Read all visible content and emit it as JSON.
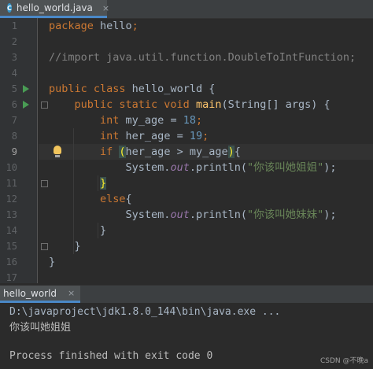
{
  "editor_tab": {
    "label": "hello_world.java",
    "close": "×"
  },
  "file_icon": "java-class-icon",
  "code_lines": [
    {
      "n": "1",
      "segs": [
        {
          "t": "package ",
          "c": "kw"
        },
        {
          "t": "hello",
          "c": ""
        },
        {
          "t": ";",
          "c": "kw"
        }
      ]
    },
    {
      "n": "2",
      "segs": []
    },
    {
      "n": "3",
      "segs": [
        {
          "t": "//import java.util.function.DoubleToIntFunction;",
          "c": "cm"
        }
      ]
    },
    {
      "n": "4",
      "segs": []
    },
    {
      "n": "5",
      "segs": [
        {
          "t": "public class ",
          "c": "kw"
        },
        {
          "t": "hello_world {",
          "c": ""
        }
      ]
    },
    {
      "n": "6",
      "segs": [
        {
          "t": "    public static void ",
          "c": "kw"
        },
        {
          "t": "main",
          "c": "fn"
        },
        {
          "t": "(String[] args) {",
          "c": ""
        }
      ]
    },
    {
      "n": "7",
      "segs": [
        {
          "t": "        int ",
          "c": "kw"
        },
        {
          "t": "my_age = ",
          "c": ""
        },
        {
          "t": "18",
          "c": "num"
        },
        {
          "t": ";",
          "c": "kw"
        }
      ]
    },
    {
      "n": "8",
      "segs": [
        {
          "t": "        int ",
          "c": "kw"
        },
        {
          "t": "her_age = ",
          "c": ""
        },
        {
          "t": "19",
          "c": "num"
        },
        {
          "t": ";",
          "c": "kw"
        }
      ]
    },
    {
      "n": "9",
      "segs": [
        {
          "t": "        if ",
          "c": "kw"
        },
        {
          "t": "(",
          "c": "br"
        },
        {
          "t": "her_age > my_age",
          "c": ""
        },
        {
          "t": ")",
          "c": "br"
        },
        {
          "t": "{",
          "c": ""
        }
      ]
    },
    {
      "n": "10",
      "segs": [
        {
          "t": "            System.",
          "c": ""
        },
        {
          "t": "out",
          "c": "it"
        },
        {
          "t": ".println(",
          "c": ""
        },
        {
          "t": "\"你该叫她姐姐\"",
          "c": "str"
        },
        {
          "t": ");",
          "c": ""
        }
      ]
    },
    {
      "n": "11",
      "segs": [
        {
          "t": "        ",
          "c": ""
        },
        {
          "t": "}",
          "c": "br"
        }
      ]
    },
    {
      "n": "12",
      "segs": [
        {
          "t": "        else",
          "c": "kw"
        },
        {
          "t": "{",
          "c": ""
        }
      ]
    },
    {
      "n": "13",
      "segs": [
        {
          "t": "            System.",
          "c": ""
        },
        {
          "t": "out",
          "c": "it"
        },
        {
          "t": ".println(",
          "c": ""
        },
        {
          "t": "\"你该叫她妹妹\"",
          "c": "str"
        },
        {
          "t": ");",
          "c": ""
        }
      ]
    },
    {
      "n": "14",
      "segs": [
        {
          "t": "        }",
          "c": ""
        }
      ]
    },
    {
      "n": "15",
      "segs": [
        {
          "t": "    }",
          "c": ""
        }
      ]
    },
    {
      "n": "16",
      "segs": [
        {
          "t": "}",
          "c": ""
        }
      ]
    },
    {
      "n": "17",
      "segs": []
    }
  ],
  "current_line": "9",
  "run_panel": {
    "tab_label": "hello_world",
    "tab_close": "×",
    "command": "D:\\javaproject\\jdk1.8.0_144\\bin\\java.exe ...",
    "output": "你该叫她姐姐",
    "exit": "Process finished with exit code 0"
  },
  "watermark": "CSDN @不晚a"
}
